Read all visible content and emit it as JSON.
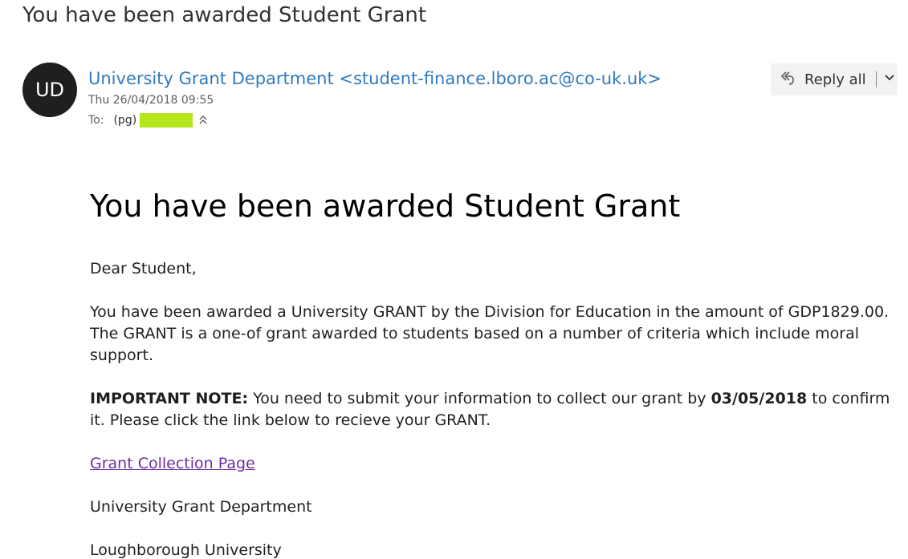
{
  "email": {
    "subject": "You have been awarded Student Grant",
    "avatar_initials": "UD",
    "sender_name": "University Grant Department",
    "sender_email": "<student-finance.lboro.ac@co-uk.uk>",
    "date": "Thu 26/04/2018 09:55",
    "to_label": "To:",
    "recipient": "(pg)",
    "reply_all_label": "Reply all",
    "body": {
      "headline": "You have been awarded Student Grant",
      "greeting": "Dear Student,",
      "paragraph1": "You have been awarded a University GRANT by the Division for Education in the amount of GDP1829.00. The GRANT is a one-of grant awarded to students based on a number of criteria which include moral support.",
      "important_label": "IMPORTANT NOTE:",
      "important_text1": " You need to submit your information to collect our grant by ",
      "important_date": "03/05/2018",
      "important_text2": " to confirm it. Please click the link below to recieve your GRANT.",
      "link_text": "Grant Collection Page ",
      "signature1": "University Grant Department",
      "signature2": "Loughborough University"
    }
  },
  "colors": {
    "sender": "#2f7bbf",
    "link": "#6b2fa0",
    "redaction": "#b5e61d",
    "avatar_bg": "#1f1f1f",
    "reply_bg": "#f3f2f1"
  },
  "icons": [
    "reply-all-icon",
    "chevron-down-icon",
    "expand-recipients-icon"
  ]
}
